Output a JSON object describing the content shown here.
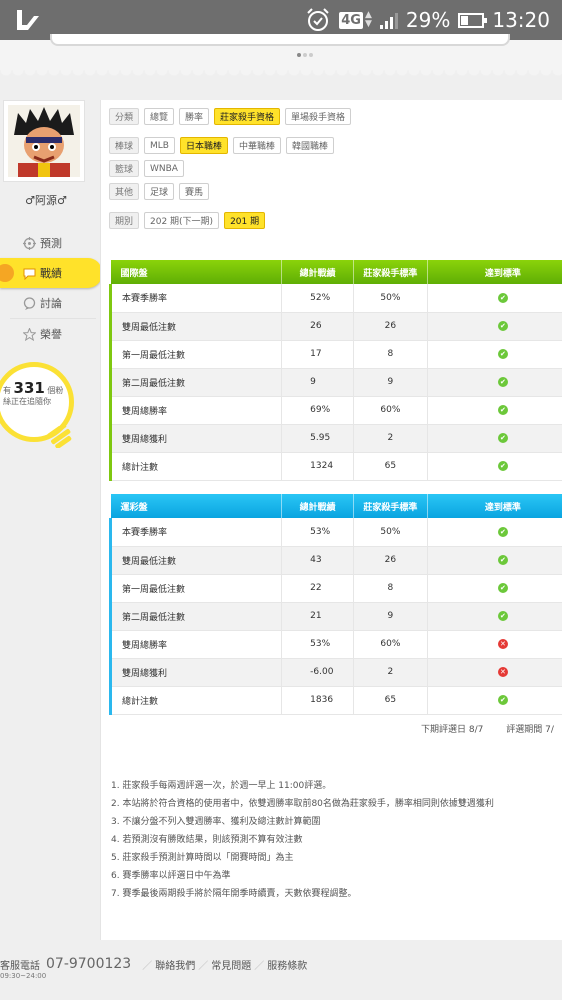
{
  "status_bar": {
    "network": "4G",
    "battery": "29%",
    "time": "13:20",
    "icons": [
      "app-logo-icon",
      "alarm-icon",
      "signal-icon",
      "battery-icon"
    ]
  },
  "profile": {
    "username": "♂阿源♂"
  },
  "nav": {
    "items": [
      {
        "label": "預測",
        "icon": "target-icon"
      },
      {
        "label": "戰績",
        "icon": "chat-bubble-icon"
      },
      {
        "label": "討論",
        "icon": "discuss-icon"
      },
      {
        "label": "榮譽",
        "icon": "star-icon"
      }
    ]
  },
  "followers": {
    "prefix": "有",
    "count": "331",
    "unit": "個粉",
    "suffix": "絲正在追隨你"
  },
  "filters": {
    "category": {
      "label": "分類",
      "options": [
        "總覽",
        "勝率",
        "莊家殺手資格",
        "單場殺手資格"
      ],
      "selected": "莊家殺手資格"
    },
    "baseball": {
      "label": "棒球",
      "options": [
        "MLB",
        "日本職棒",
        "中華職棒",
        "韓國職棒"
      ],
      "selected": "日本職棒"
    },
    "basketball": {
      "label": "籃球",
      "options": [
        "WNBA"
      ]
    },
    "other": {
      "label": "其他",
      "options": [
        "足球",
        "賽馬"
      ]
    },
    "period": {
      "label": "期別",
      "options": [
        "202 期(下一期)",
        "201 期"
      ],
      "selected": "201 期"
    }
  },
  "tables": [
    {
      "title": "國際盤",
      "headers": [
        "總計戰績",
        "莊家殺手標準",
        "達到標準"
      ],
      "rows": [
        {
          "label": "本賽季勝率",
          "value": "52%",
          "standard": "50%",
          "met": true
        },
        {
          "label": "雙周最低注數",
          "value": "26",
          "standard": "26",
          "met": true
        },
        {
          "label": "第一周最低注數",
          "value": "17",
          "standard": "8",
          "met": true
        },
        {
          "label": "第二周最低注數",
          "value": "9",
          "standard": "9",
          "met": true
        },
        {
          "label": "雙周總勝率",
          "value": "69%",
          "standard": "60%",
          "met": true
        },
        {
          "label": "雙周總獲利",
          "value": "5.95",
          "standard": "2",
          "met": true
        },
        {
          "label": "總計注數",
          "value": "1324",
          "standard": "65",
          "met": true
        }
      ]
    },
    {
      "title": "運彩盤",
      "headers": [
        "總計戰績",
        "莊家殺手標準",
        "達到標準"
      ],
      "rows": [
        {
          "label": "本賽季勝率",
          "value": "53%",
          "standard": "50%",
          "met": true
        },
        {
          "label": "雙周最低注數",
          "value": "43",
          "standard": "26",
          "met": true
        },
        {
          "label": "第一周最低注數",
          "value": "22",
          "standard": "8",
          "met": true
        },
        {
          "label": "第二周最低注數",
          "value": "21",
          "standard": "9",
          "met": true
        },
        {
          "label": "雙周總勝率",
          "value": "53%",
          "standard": "60%",
          "met": false
        },
        {
          "label": "雙周總獲利",
          "value": "-6.00",
          "standard": "2",
          "met": false
        },
        {
          "label": "總計注數",
          "value": "1836",
          "standard": "65",
          "met": true
        }
      ]
    }
  ],
  "dates": {
    "next_review": "下期評選日 8/7",
    "review_period": "評選期間 7/"
  },
  "notes": [
    "1. 莊家殺手每兩週評選一次，於週一早上 11:00評選。",
    "2. 本站將於符合資格的使用者中，依雙週勝率取前80名做為莊家殺手，勝率相同則依據雙週獲利",
    "3. 不讓分盤不列入雙週勝率、獲利及總注數計算範圍",
    "4. 若預測沒有勝敗結果，則該預測不算有效注數",
    "5. 莊家殺手預測計算時間以「開賽時間」為主",
    "6. 賽季勝率以評選日中午為準",
    "7. 賽季最後兩期殺手將於隔年開季時續賣，天數依賽程調整。"
  ],
  "footer": {
    "service_label": "客服電話",
    "phone": "07-9700123",
    "hours": "09:30~24:00",
    "links": [
      "聯絡我們",
      "常見問題",
      "服務條款"
    ]
  }
}
